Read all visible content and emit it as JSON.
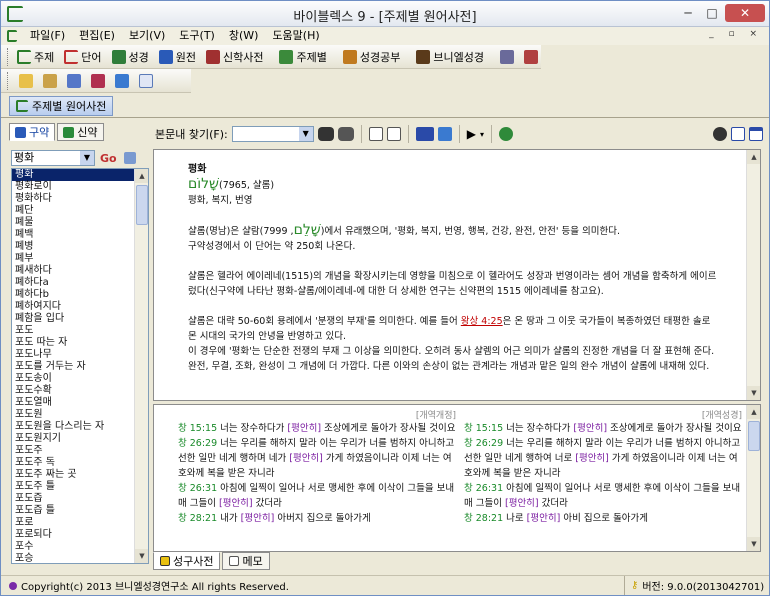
{
  "window": {
    "title": "바이블렉스 9 - [주제별 원어사전]",
    "min": "─",
    "max": "□",
    "close": "✕"
  },
  "menu": {
    "items": [
      "파일(F)",
      "편집(E)",
      "보기(V)",
      "도구(T)",
      "창(W)",
      "도움말(H)"
    ],
    "doc_controls": "_ ▫ ×"
  },
  "toolbar1": {
    "items": [
      "주제",
      "단어",
      "성경",
      "원전",
      "신학사전",
      "주제별",
      "성경공부",
      "브니엘성경"
    ]
  },
  "doc_tab": {
    "label": "주제별 원어사전"
  },
  "left": {
    "tab_korean": "구약",
    "tab_greek": "신약",
    "search_value": "평화",
    "go_label": "Go",
    "words": [
      "평화",
      "평화로이",
      "평화하다",
      "폐단",
      "폐물",
      "폐백",
      "폐병",
      "폐부",
      "폐새하다",
      "폐하다a",
      "폐하다b",
      "폐하여지다",
      "폐함을 입다",
      "포도",
      "포도 따는 자",
      "포도나무",
      "포도를 거두는 자",
      "포도송이",
      "포도수확",
      "포도열매",
      "포도원",
      "포도원을 다스리는 자",
      "포도원지기",
      "포도주",
      "포도주 독",
      "포도주 짜는 곳",
      "포도주 틀",
      "포도즙",
      "포도즙 틀",
      "포로",
      "포로되다",
      "포수",
      "포승",
      "포악하다",
      "포악한 자"
    ]
  },
  "content_toolbar": {
    "search_label": "본문내 찾기(F):"
  },
  "content": {
    "headword": "평화",
    "hebrew": "שָׁלוֹם",
    "number": "(7965, 샬롬)",
    "gloss": "평화, 복지, 번영",
    "para1_a": "샬롬(명남)은 샬람(",
    "hebrew2": "שָׁלֵם",
    "para1_b": ", 7999)에서 유래했으며, '평화, 복지, 번영, 행복, 건강, 완전, 안전' 등을 의미한다.",
    "para2": "구약성경에서 이 단어는 약 250회 나온다.",
    "para3": "샬롬은 헬라어 에이레네(1515)의 개념을 확장시키는데 영향을 미침으로 이 헬라어도 성장과 번영이라는 셈어 개념을 함축하게 에이르렀다(신구약에 나타난 평화-샬롬/에이레네-에 대한 더 상세한 연구는 신약편의 1515 에이레네를 참고요).",
    "para4_a": "샬롬은 대략 50-60회 용례에서 '분쟁의 부재'를 의미한다. 예를 들어 ",
    "para4_ref": "왕상 4:25",
    "para4_b": "은 온 땅과 그 이웃 국가들이 복종하였던 태평한 솔로몬 시대의 국가의 안녕을 반영하고 있다.",
    "para5": "이 경우에 '평화'는 단순한 전쟁의 부재 그 이상을 의미한다. 오히려 동사 샬렘의 어근 의미가 샬롬의 진정한 개념을 더 잘 표현해 준다. 완전, 무결, 조화, 완성이 그 개념에 더 가깝다. 다른 이와의 손상이 없는 관계라는 개념과 맡은 일의 완수 개념이 샬롬에 내재해 있다."
  },
  "parallel": {
    "left_caption": "[개역개정]",
    "right_caption": "[개역성경]",
    "left": [
      {
        "ref": "창 15:15",
        "text": " 너는 장수하다가 ",
        "kw": "[평안히]",
        "rest": " 조상에게로 돌아가 장사될 것이요"
      },
      {
        "ref": "창 26:29",
        "text": " 너는 우리를 해하지 말라 이는 우리가 너를 범하지 아니하고 선한 일만 네게 행하며 네가 ",
        "kw": "[평안히]",
        "rest": " 가게 하였음이니라 이제 너는 여호와께 복을 받은 자니라"
      },
      {
        "ref": "창 26:31",
        "text": " 아침에 일찍이 일어나 서로 맹세한 후에 이삭이 그들을 보내매 그들이 ",
        "kw": "[평안히]",
        "rest": " 갔더라"
      },
      {
        "ref": "창 28:21",
        "text": " 내가 ",
        "kw": "[평안히]",
        "rest": " 아버지 집으로 돌아가게"
      }
    ],
    "right": [
      {
        "ref": "창 15:15",
        "text": " 너는 장수하다가 ",
        "kw": "[평안히]",
        "rest": " 조상에게로 돌아가 장사될 것이요"
      },
      {
        "ref": "창 26:29",
        "text": " 너는 우리를 해하지 말라 이는 우리가 너를 범하지 아니하고 선한 일만 네게 행하여 너로 ",
        "kw": "[평안히]",
        "rest": " 가게 하였음이니라 이제 너는 여호와께 복을 받은 자니라"
      },
      {
        "ref": "창 26:31",
        "text": " 아침에 일찍이 일어나 서로 맹세한 후에 이삭이 그들을 보내매 그들이 ",
        "kw": "[평안히]",
        "rest": " 갔더라"
      },
      {
        "ref": "창 28:21",
        "text": " 나로 ",
        "kw": "[평안히]",
        "rest": " 아비 집으로 돌아가게"
      }
    ]
  },
  "bottom_tabs": {
    "dict": "성구사전",
    "memo": "메모"
  },
  "status": {
    "copyright": "Copyright(c) 2013 브니엘성경연구소 All rights Reserved.",
    "version": "버전: 9.0.0(2013042701)"
  }
}
